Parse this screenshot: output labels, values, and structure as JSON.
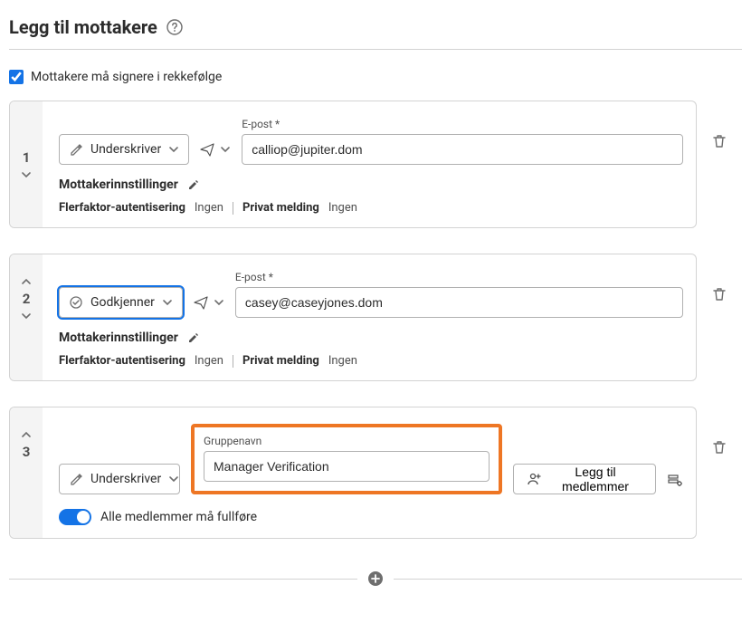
{
  "title": "Legg til mottakere",
  "mustSignInOrder": {
    "label": "Mottakere må signere i rekkefølge",
    "checked": true
  },
  "recipients": [
    {
      "order": "1",
      "role": "Underskriver",
      "emailLabel": "E-post",
      "email": "calliop@jupiter.dom",
      "settingsLabel": "Mottakerinnstillinger",
      "mfa": {
        "label": "Flerfaktor-autentisering",
        "value": "Ingen"
      },
      "privateMsg": {
        "label": "Privat melding",
        "value": "Ingen"
      }
    },
    {
      "order": "2",
      "role": "Godkjenner",
      "emailLabel": "E-post",
      "email": "casey@caseyjones.dom",
      "settingsLabel": "Mottakerinnstillinger",
      "mfa": {
        "label": "Flerfaktor-autentisering",
        "value": "Ingen"
      },
      "privateMsg": {
        "label": "Privat melding",
        "value": "Ingen"
      }
    },
    {
      "order": "3",
      "role": "Underskriver",
      "groupNameLabel": "Gruppenavn",
      "groupName": "Manager Verification",
      "addMembersLabel": "Legg til medlemmer",
      "allMustCompleteLabel": "Alle medlemmer må fullføre"
    }
  ]
}
